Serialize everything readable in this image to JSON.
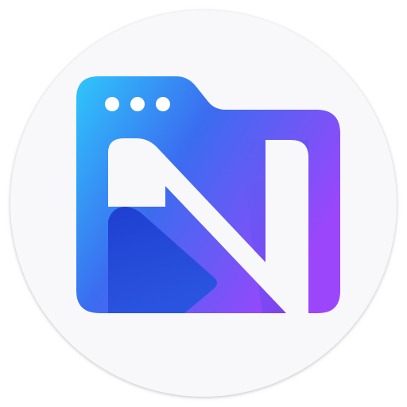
{
  "icon": {
    "name": "folder-n-app-icon",
    "colors": {
      "background_circle": "#f8f8fb",
      "circle_shadow": "#c9c9cf",
      "gradient_start": "#2fc6fb",
      "gradient_mid": "#3b6cf0",
      "gradient_end": "#9b46fb",
      "letter_fill": "#f8f8fb",
      "dark_shard_top": "#1f3fd0",
      "dark_shard_bottom": "#2a54e0",
      "window_dots": "#ffffff"
    }
  }
}
